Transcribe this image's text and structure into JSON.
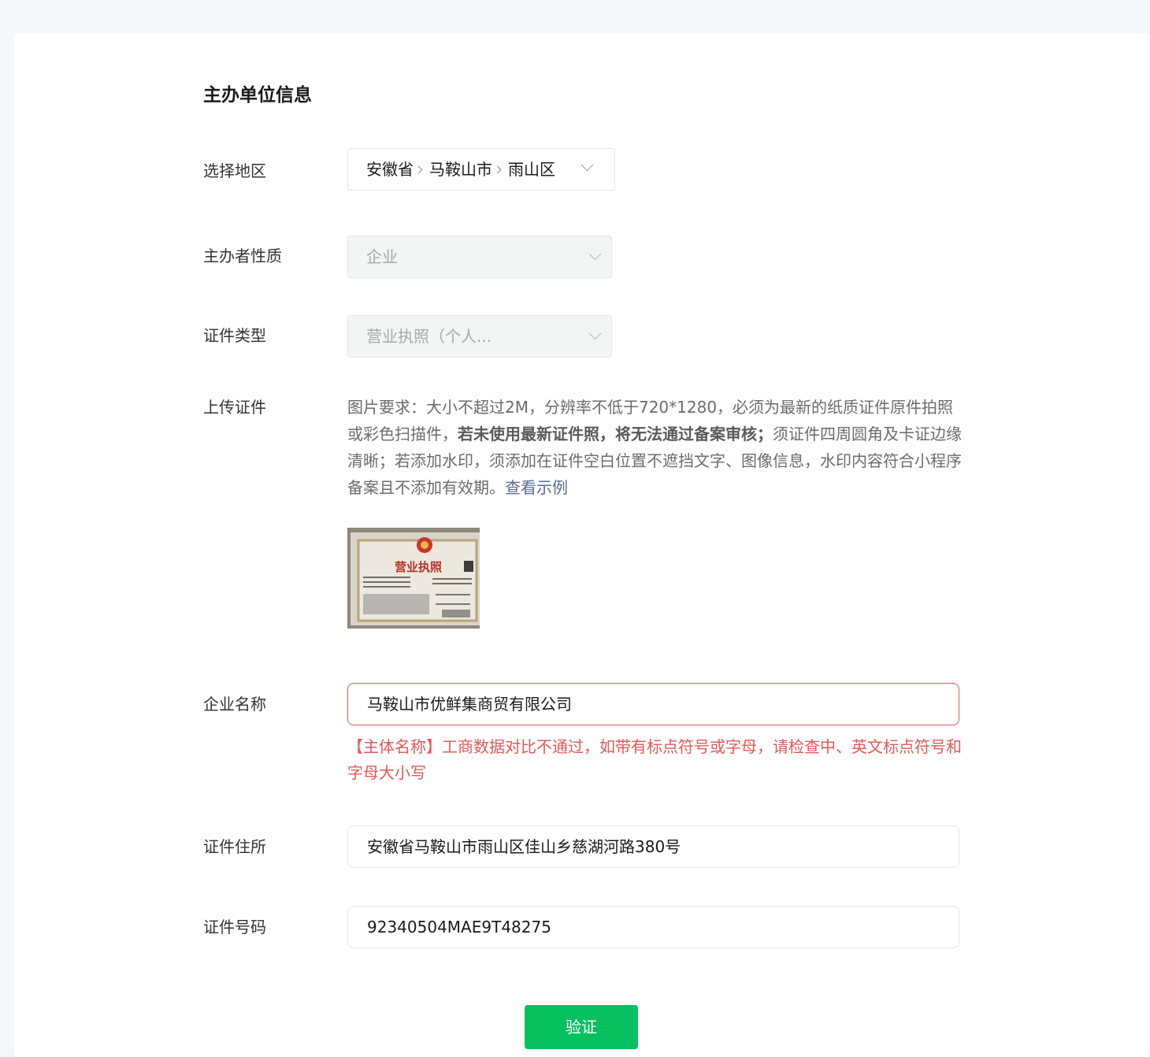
{
  "section": {
    "title": "主办单位信息"
  },
  "region": {
    "label": "选择地区",
    "province": "安徽省",
    "city": "马鞍山市",
    "district": "雨山区"
  },
  "sponsor_type": {
    "label": "主办者性质",
    "value": "企业"
  },
  "cert_type": {
    "label": "证件类型",
    "value": "营业执照（个人..."
  },
  "upload": {
    "label": "上传证件",
    "hint_part1": "图片要求：大小不超过2M，分辨率不低于720*1280，必须为最新的纸质证件原件拍照或彩色扫描件，",
    "hint_bold": "若未使用最新证件照，将无法通过备案审核；",
    "hint_part2": "须证件四周圆角及卡证边缘清晰；若添加水印，须添加在证件空白位置不遮挡文字、图像信息，水印内容符合小程序备案且不添加有效期。",
    "example_link": "查看示例",
    "thumbnail_title": "营业执照"
  },
  "company_name": {
    "label": "企业名称",
    "value": "马鞍山市优鲜集商贸有限公司",
    "error": "【主体名称】工商数据对比不通过，如带有标点符号或字母，请检查中、英文标点符号和字母大小写"
  },
  "address": {
    "label": "证件住所",
    "value": "安徽省马鞍山市雨山区佳山乡慈湖河路380号"
  },
  "cert_number": {
    "label": "证件号码",
    "value": "92340504MAE9T48275"
  },
  "submit": {
    "label": "验证"
  },
  "colors": {
    "primary": "#07c160",
    "error": "#e85656",
    "link": "#576b95"
  }
}
